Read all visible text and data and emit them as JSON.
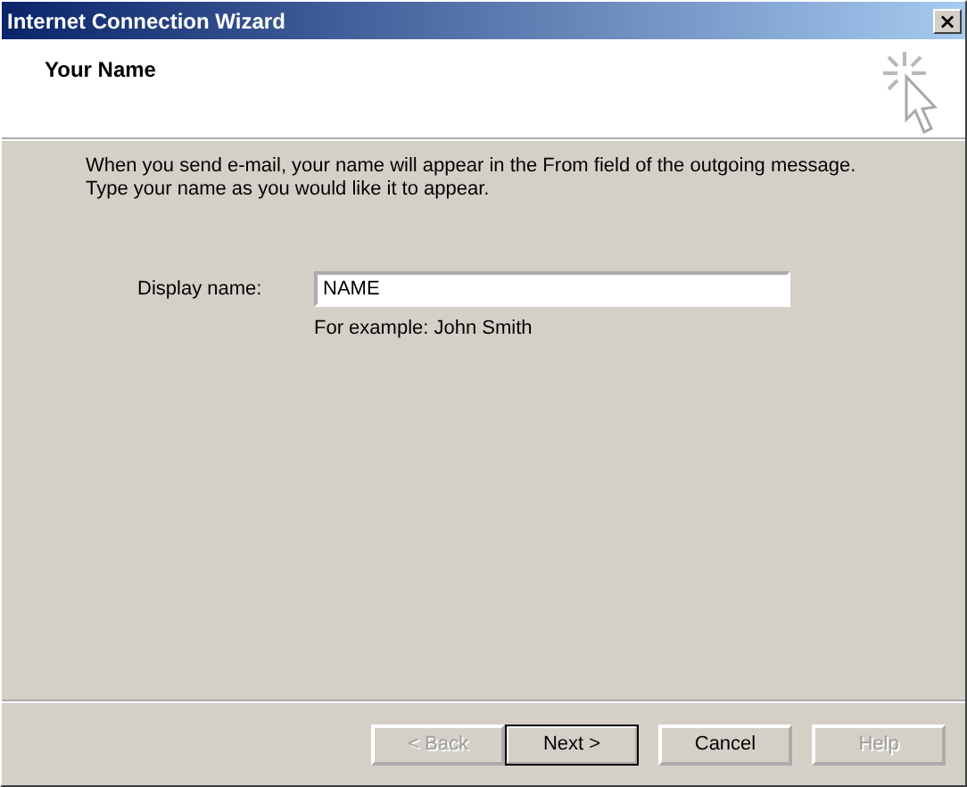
{
  "window": {
    "title": "Internet Connection Wizard",
    "close": "×"
  },
  "header": {
    "title": "Your Name"
  },
  "intro": "When you send e-mail, your name will appear in the From field of the outgoing message.\nType your name as you would like it to appear.",
  "field": {
    "label": "Display name:",
    "value": "NAME",
    "example": "For example: John Smith"
  },
  "buttons": [
    {
      "label": "< Back",
      "disabled": true,
      "default": false
    },
    {
      "label": "Next >",
      "disabled": false,
      "default": true
    },
    {
      "label": "Cancel",
      "disabled": false,
      "default": false
    },
    {
      "label": "Help",
      "disabled": true,
      "default": false
    }
  ]
}
